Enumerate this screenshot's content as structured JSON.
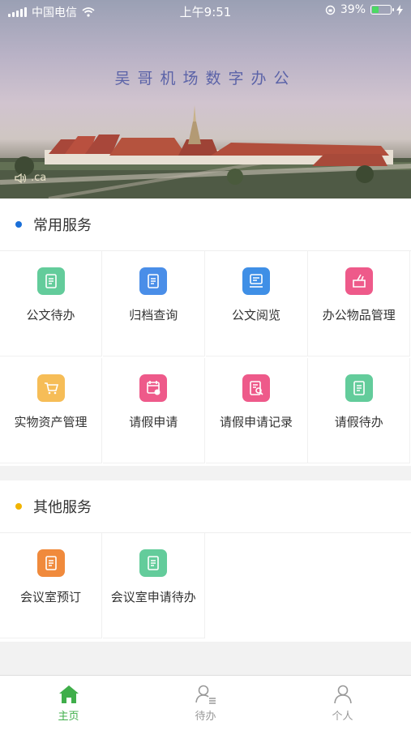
{
  "status_bar": {
    "carrier": "中国电信",
    "time": "上午9:51",
    "battery": "39%",
    "battery_level": 0.39
  },
  "banner": {
    "title": "吴哥机场数字办公",
    "sound_text": ".ca"
  },
  "sections": [
    {
      "title": "常用服务",
      "dot_color": "#1a6fd8",
      "items": [
        {
          "label": "公文待办",
          "icon": "document-todo-icon",
          "color": "#63cc9b"
        },
        {
          "label": "归档查询",
          "icon": "archive-search-icon",
          "color": "#4a8ee8"
        },
        {
          "label": "公文阅览",
          "icon": "document-read-icon",
          "color": "#3f8fe6"
        },
        {
          "label": "办公物品管理",
          "icon": "office-supplies-icon",
          "color": "#ee5a8a"
        },
        {
          "label": "实物资产管理",
          "icon": "asset-cart-icon",
          "color": "#f6bd57"
        },
        {
          "label": "请假申请",
          "icon": "leave-apply-icon",
          "color": "#ee5a8a"
        },
        {
          "label": "请假申请记录",
          "icon": "leave-record-icon",
          "color": "#ee5a8a"
        },
        {
          "label": "请假待办",
          "icon": "leave-todo-icon",
          "color": "#63cc9b"
        }
      ]
    },
    {
      "title": "其他服务",
      "dot_color": "#f1b400",
      "items": [
        {
          "label": "会议室预订",
          "icon": "meeting-room-book-icon",
          "color": "#f08a3c"
        },
        {
          "label": "会议室申请待办",
          "icon": "meeting-room-todo-icon",
          "color": "#63cc9b"
        }
      ]
    }
  ],
  "tabs": [
    {
      "label": "主页",
      "icon": "home-icon",
      "active": true
    },
    {
      "label": "待办",
      "icon": "todo-user-icon",
      "active": false
    },
    {
      "label": "个人",
      "icon": "profile-icon",
      "active": false
    }
  ]
}
